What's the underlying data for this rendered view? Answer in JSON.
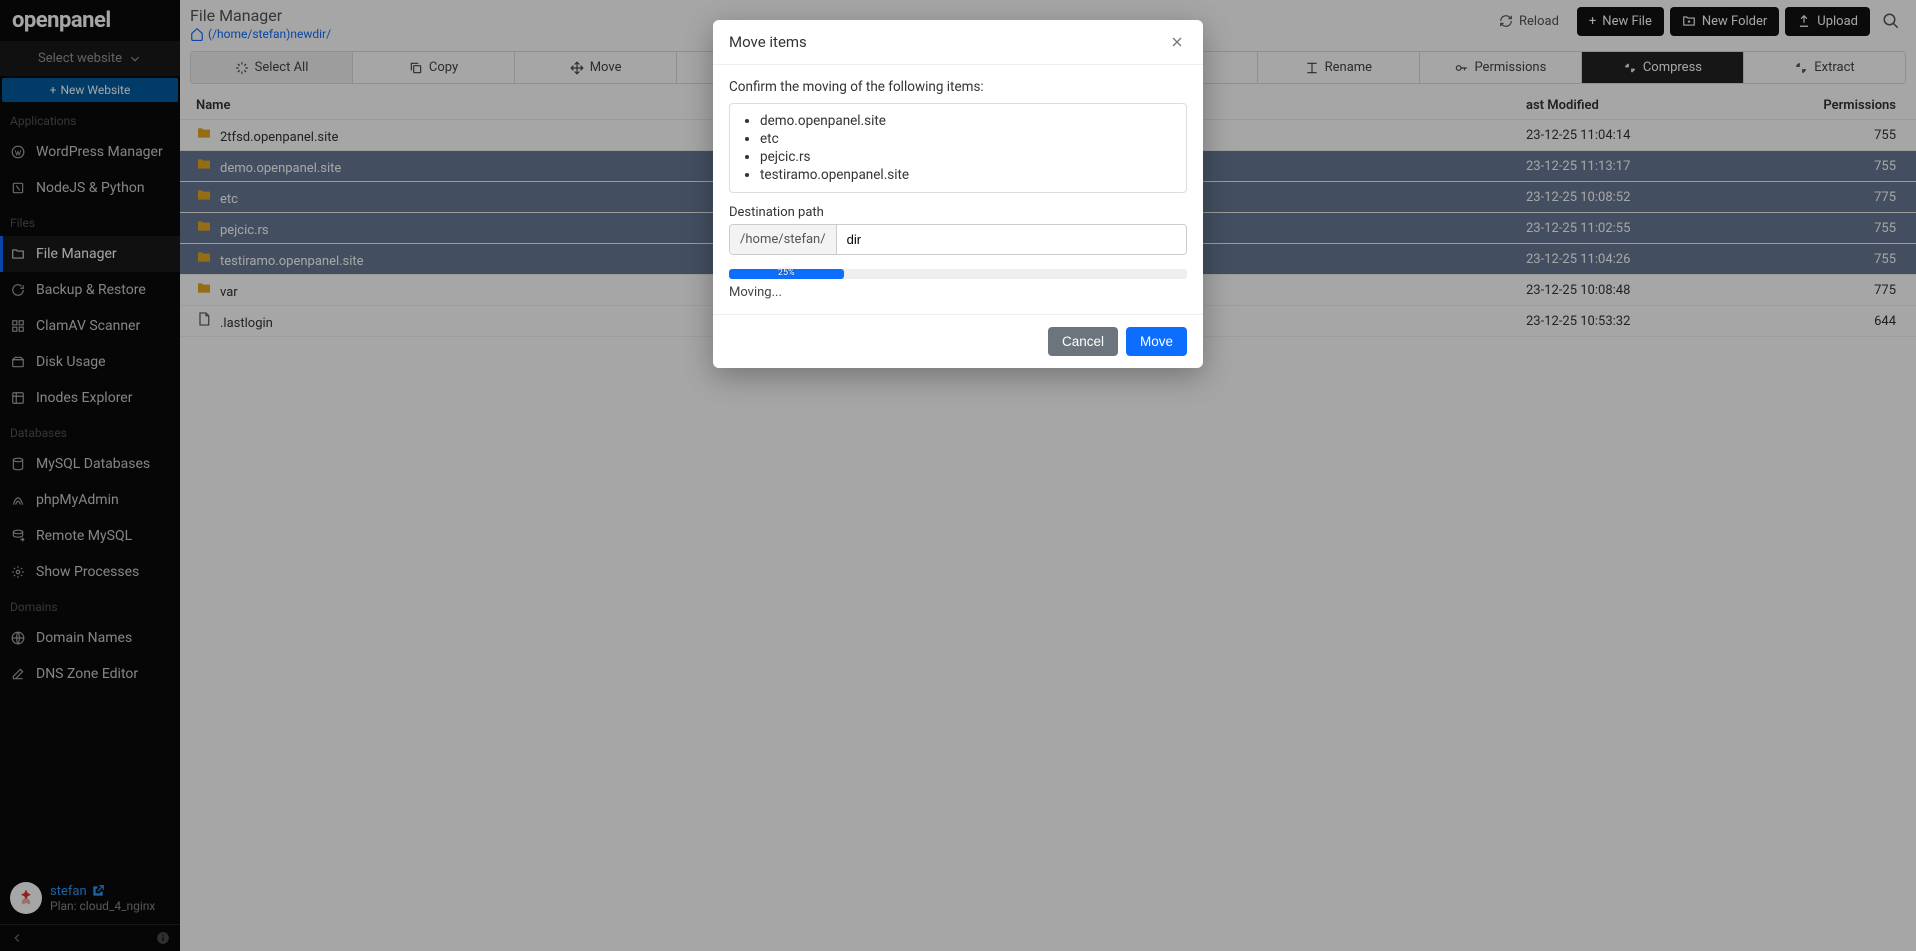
{
  "brand": "openpanel",
  "website_select_label": "Select website",
  "new_website_label": "New Website",
  "sidebar": {
    "sections": [
      {
        "title": "Applications",
        "items": [
          {
            "label": "WordPress Manager",
            "icon": "wordpress"
          },
          {
            "label": "NodeJS & Python",
            "icon": "node"
          }
        ]
      },
      {
        "title": "Files",
        "items": [
          {
            "label": "File Manager",
            "icon": "folder",
            "active": true
          },
          {
            "label": "Backup & Restore",
            "icon": "backup"
          },
          {
            "label": "ClamAV Scanner",
            "icon": "scan"
          },
          {
            "label": "Disk Usage",
            "icon": "disk"
          },
          {
            "label": "Inodes Explorer",
            "icon": "inodes"
          }
        ]
      },
      {
        "title": "Databases",
        "items": [
          {
            "label": "MySQL Databases",
            "icon": "db"
          },
          {
            "label": "phpMyAdmin",
            "icon": "pma"
          },
          {
            "label": "Remote MySQL",
            "icon": "remote"
          },
          {
            "label": "Show Processes",
            "icon": "proc"
          }
        ]
      },
      {
        "title": "Domains",
        "items": [
          {
            "label": "Domain Names",
            "icon": "globe"
          },
          {
            "label": "DNS Zone Editor",
            "icon": "dns"
          }
        ]
      }
    ]
  },
  "user": {
    "name": "stefan",
    "plan": "Plan: cloud_4_nginx"
  },
  "page": {
    "title": "File Manager",
    "breadcrumb": "(/home/stefan)newdir/"
  },
  "header_buttons": {
    "reload": "Reload",
    "new_file": "New File",
    "new_folder": "New Folder",
    "upload": "Upload"
  },
  "toolbar": {
    "select_all": "Select All",
    "copy": "Copy",
    "move": "Move",
    "rename": "Rename",
    "permissions": "Permissions",
    "compress": "Compress",
    "extract": "Extract"
  },
  "table": {
    "columns": {
      "name": "Name",
      "modified": "ast Modified",
      "perm": "Permissions"
    },
    "rows": [
      {
        "name": "2tfsd.openpanel.site",
        "type": "folder",
        "modified": "23-12-25 11:04:14",
        "perm": "755",
        "selected": false
      },
      {
        "name": "demo.openpanel.site",
        "type": "folder",
        "modified": "23-12-25 11:13:17",
        "perm": "755",
        "selected": true
      },
      {
        "name": "etc",
        "type": "folder",
        "modified": "23-12-25 10:08:52",
        "perm": "775",
        "selected": true
      },
      {
        "name": "pejcic.rs",
        "type": "folder",
        "modified": "23-12-25 11:02:55",
        "perm": "755",
        "selected": true
      },
      {
        "name": "testiramo.openpanel.site",
        "type": "folder",
        "modified": "23-12-25 11:04:26",
        "perm": "755",
        "selected": true
      },
      {
        "name": "var",
        "type": "folder",
        "modified": "23-12-25 10:08:48",
        "perm": "775",
        "selected": false
      },
      {
        "name": ".lastlogin",
        "type": "file",
        "modified": "23-12-25 10:53:32",
        "perm": "644",
        "selected": false
      }
    ]
  },
  "modal": {
    "title": "Move items",
    "confirm_text": "Confirm the moving of the following items:",
    "items": [
      "demo.openpanel.site",
      "etc",
      "pejcic.rs",
      "testiramo.openpanel.site"
    ],
    "dest_label": "Destination path",
    "dest_prefix": "/home/stefan/",
    "dest_value": "dir",
    "progress_percent": 25,
    "progress_label": "25%",
    "status": "Moving...",
    "cancel": "Cancel",
    "move": "Move"
  }
}
